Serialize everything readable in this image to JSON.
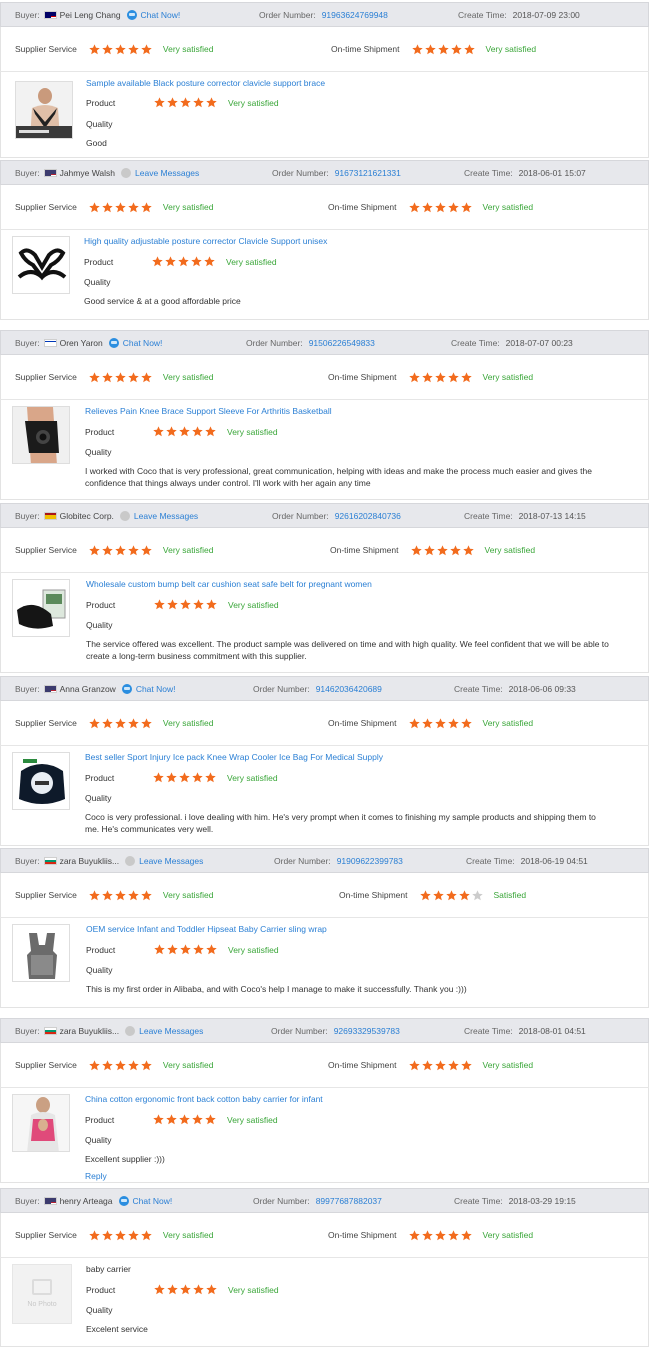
{
  "labels": {
    "buyer": "Buyer:",
    "order_number": "Order Number:",
    "create_time": "Create Time:",
    "supplier_service": "Supplier Service",
    "ontime_shipment": "On-time Shipment",
    "product": "Product",
    "quality": "Quality"
  },
  "colors": {
    "star": "#f26b1d",
    "star_empty": "#cccccc",
    "link": "#2a7fd4",
    "satisfied": "#3aa639",
    "header_bg": "#e7e8ec"
  },
  "reviews": [
    {
      "buyer": "Pei Leng Chang",
      "flag": "malaysia",
      "contact": "Chat Now!",
      "contact_icon": "chat-icon",
      "order": "91963624769948",
      "time": "2018-07-09 23:00",
      "supplier_stars": 5,
      "supplier_text": "Very satisfied",
      "shipment_stars": 5,
      "shipment_text": "Very satisfied",
      "product_title": "Sample available Black posture corrector clavicle support brace",
      "product_stars": 5,
      "product_text": "Very satisfied",
      "comment": "Good",
      "thumb": "posture-brace-photo"
    },
    {
      "buyer": "Jahmye Walsh",
      "flag": "usa",
      "contact": "Leave Messages",
      "contact_icon": "message-icon",
      "order": "91673121621331",
      "time": "2018-06-01 15:07",
      "supplier_stars": 5,
      "supplier_text": "Very satisfied",
      "shipment_stars": 5,
      "shipment_text": "Very satisfied",
      "product_title": "High quality adjustable posture corrector Clavicle Support unisex",
      "product_stars": 5,
      "product_text": "Very satisfied",
      "comment": "Good service & at a good affordable price",
      "thumb": "posture-strap-photo"
    },
    {
      "buyer": "Oren Yaron",
      "flag": "israel",
      "contact": "Chat Now!",
      "contact_icon": "chat-icon",
      "order": "91506226549833",
      "time": "2018-07-07 00:23",
      "supplier_stars": 5,
      "supplier_text": "Very satisfied",
      "shipment_stars": 5,
      "shipment_text": "Very satisfied",
      "product_title": "Relieves Pain Knee Brace Support Sleeve For Arthritis Basketball",
      "product_stars": 5,
      "product_text": "Very satisfied",
      "comment": "I worked with Coco that is very professional, great communication, helping with ideas and make the process much easier and gives the confidence that things always under control. I'll work with her again any time",
      "thumb": "knee-brace-photo"
    },
    {
      "buyer": "Globitec Corp.",
      "flag": "spain",
      "contact": "Leave Messages",
      "contact_icon": "message-icon",
      "order": "92616202840736",
      "time": "2018-07-13 14:15",
      "supplier_stars": 5,
      "supplier_text": "Very satisfied",
      "shipment_stars": 5,
      "shipment_text": "Very satisfied",
      "product_title": "Wholesale custom bump belt car cushion seat safe belt for pregnant women",
      "product_stars": 5,
      "product_text": "Very satisfied",
      "comment": "The service offered was excellent. The product sample was delivered on time and with high quality. We feel confident that we will be able to create a long-term business commitment with this supplier.",
      "thumb": "seat-belt-cushion-photo"
    },
    {
      "buyer": "Anna Granzow",
      "flag": "usa",
      "contact": "Chat Now!",
      "contact_icon": "chat-icon",
      "order": "91462036420689",
      "time": "2018-06-06 09:33",
      "supplier_stars": 5,
      "supplier_text": "Very satisfied",
      "shipment_stars": 5,
      "shipment_text": "Very satisfied",
      "product_title": "Best seller Sport Injury Ice pack Knee Wrap Cooler Ice Bag For Medical Supply",
      "product_stars": 5,
      "product_text": "Very satisfied",
      "comment": "Coco is very professional. i love dealing with him. He's very prompt when it comes to finishing my sample products and shipping them to me. He's communicates very well.",
      "thumb": "ice-pack-photo"
    },
    {
      "buyer": "zara Buyukliis...",
      "flag": "bulgaria",
      "contact": "Leave Messages",
      "contact_icon": "message-icon",
      "order": "91909622399783",
      "time": "2018-06-19 04:51",
      "supplier_stars": 5,
      "supplier_text": "Very satisfied",
      "shipment_stars": 4,
      "shipment_text": "Satisfied",
      "product_title": "OEM service Infant and Toddler Hipseat Baby Carrier sling wrap",
      "product_stars": 5,
      "product_text": "Very satisfied",
      "comment": "This is my first order in Alibaba, and with Coco's help I manage to make it successfully. Thank you :)))",
      "thumb": "baby-carrier-photo"
    },
    {
      "buyer": "zara Buyukliis...",
      "flag": "bulgaria",
      "contact": "Leave Messages",
      "contact_icon": "message-icon",
      "order": "92693329539783",
      "time": "2018-08-01 04:51",
      "supplier_stars": 5,
      "supplier_text": "Very satisfied",
      "shipment_stars": 5,
      "shipment_text": "Very satisfied",
      "product_title": "China cotton ergonomic front back cotton baby carrier for infant",
      "product_stars": 5,
      "product_text": "Very satisfied",
      "comment": "Excellent supplier :)))",
      "reply": "Reply",
      "thumb": "baby-carrier-model-photo"
    },
    {
      "buyer": "henry Arteaga",
      "flag": "usa",
      "contact": "Chat Now!",
      "contact_icon": "chat-icon",
      "order": "89977687882037",
      "time": "2018-03-29 19:15",
      "supplier_stars": 5,
      "supplier_text": "Very satisfied",
      "shipment_stars": 5,
      "shipment_text": "Very satisfied",
      "product_title": "baby carrier",
      "product_title_plain": true,
      "product_stars": 5,
      "product_text": "Very satisfied",
      "comment": "Excelent service",
      "thumb": "no-photo-placeholder",
      "no_photo": "No Photo"
    }
  ]
}
